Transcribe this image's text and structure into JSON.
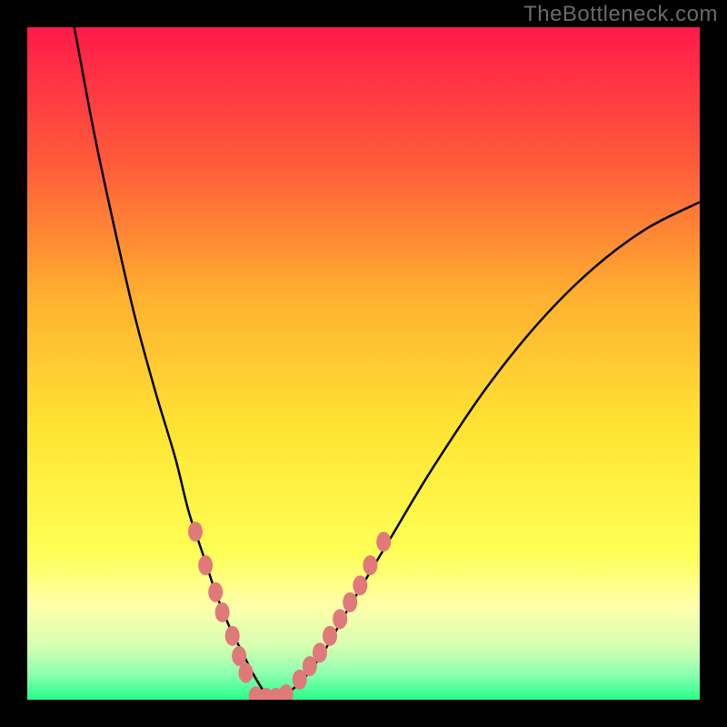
{
  "watermark": "TheBottleneck.com",
  "chart_data": {
    "type": "line",
    "title": "",
    "xlabel": "",
    "ylabel": "",
    "xlim": [
      0,
      100
    ],
    "ylim": [
      0,
      100
    ],
    "background_gradient": {
      "stops": [
        {
          "offset": 0,
          "color": "#ff1a4a"
        },
        {
          "offset": 20,
          "color": "#ff5a3a"
        },
        {
          "offset": 40,
          "color": "#ffb030"
        },
        {
          "offset": 60,
          "color": "#ffe533"
        },
        {
          "offset": 78,
          "color": "#ffff55"
        },
        {
          "offset": 86,
          "color": "#ffffaa"
        },
        {
          "offset": 92,
          "color": "#d6ffb0"
        },
        {
          "offset": 96,
          "color": "#8fffb0"
        },
        {
          "offset": 100,
          "color": "#27ff8a"
        }
      ]
    },
    "series": [
      {
        "name": "curve",
        "type": "line",
        "color": "#000000",
        "x": [
          7,
          10,
          13,
          16,
          19,
          22,
          24,
          26,
          28,
          30,
          32,
          33.5,
          35,
          36,
          40,
          44,
          48,
          54,
          60,
          68,
          76,
          84,
          92,
          100
        ],
        "y": [
          100,
          84,
          70,
          57,
          46,
          36,
          28,
          22,
          16,
          11,
          7,
          4,
          1.5,
          0,
          2,
          7,
          14,
          24,
          34,
          46,
          56,
          64,
          70,
          74
        ]
      },
      {
        "name": "dots-left",
        "type": "scatter",
        "color": "#e07a7a",
        "x": [
          25.0,
          26.5,
          28.0,
          29.0,
          30.5,
          31.5,
          32.5
        ],
        "y": [
          25.0,
          20.0,
          16.0,
          13.0,
          9.5,
          6.5,
          4.0
        ]
      },
      {
        "name": "dots-bottom",
        "type": "scatter",
        "color": "#e07a7a",
        "x": [
          34.0,
          35.5,
          37.0,
          38.5
        ],
        "y": [
          0.5,
          0.3,
          0.3,
          0.8
        ]
      },
      {
        "name": "dots-right",
        "type": "scatter",
        "color": "#e07a7a",
        "x": [
          40.5,
          42.0,
          43.5,
          45.0,
          46.5,
          48.0,
          49.5,
          51.0,
          53.0
        ],
        "y": [
          3.0,
          5.0,
          7.0,
          9.5,
          12.0,
          14.5,
          17.0,
          20.0,
          23.5
        ]
      }
    ]
  }
}
